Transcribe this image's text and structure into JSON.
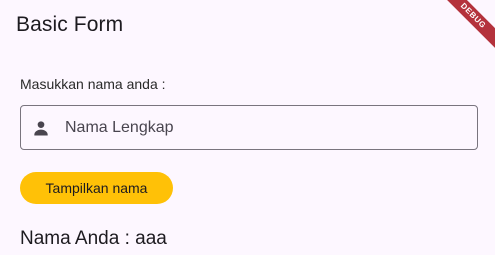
{
  "app_bar": {
    "title": "Basic Form",
    "debug_banner": "DEBUG"
  },
  "form": {
    "label": "Masukkan nama anda :",
    "input": {
      "placeholder": "Nama Lengkap",
      "value": "",
      "icon": "person-icon"
    },
    "button_label": "Tampilkan nama",
    "result_text": "Nama Anda : aaa"
  },
  "colors": {
    "background": "#fdf7ff",
    "button": "#ffc107",
    "debug_banner": "#b4323c",
    "field_border": "#79747e"
  }
}
